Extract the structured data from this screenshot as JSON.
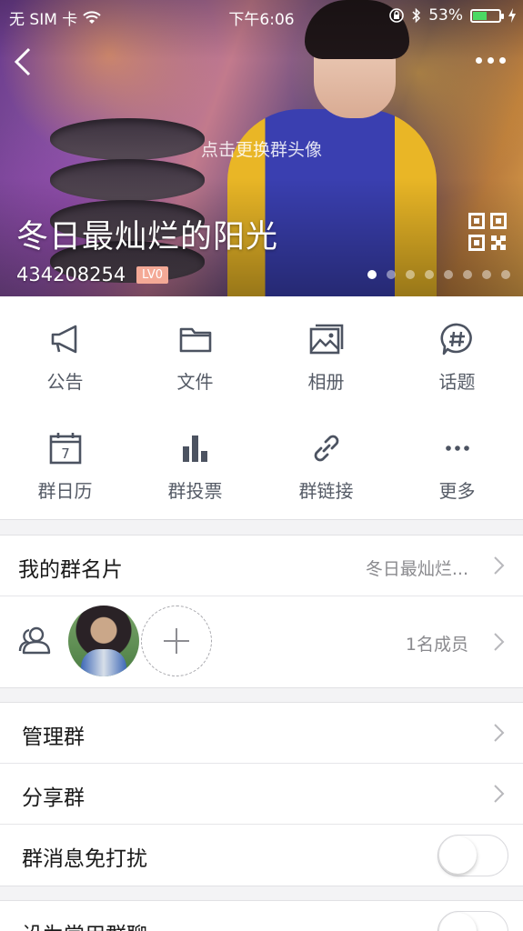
{
  "status_bar": {
    "carrier": "无 SIM 卡",
    "time": "下午6:06",
    "battery": "53%",
    "battery_level": 0.53
  },
  "header": {
    "avatar_hint": "点击更换群头像",
    "group_name": "冬日最灿烂的阳光",
    "group_id": "434208254",
    "level": "LV0",
    "carousel_pages": 8,
    "carousel_active": 0
  },
  "features": [
    {
      "label": "公告",
      "icon": "megaphone-icon"
    },
    {
      "label": "文件",
      "icon": "folder-icon"
    },
    {
      "label": "相册",
      "icon": "album-icon"
    },
    {
      "label": "话题",
      "icon": "topic-icon"
    },
    {
      "label": "群日历",
      "icon": "calendar-icon",
      "day": "7"
    },
    {
      "label": "群投票",
      "icon": "vote-icon"
    },
    {
      "label": "群链接",
      "icon": "link-icon"
    },
    {
      "label": "更多",
      "icon": "more-icon"
    }
  ],
  "card_section": {
    "my_card_label": "我的群名片",
    "my_card_value": "冬日最灿烂...",
    "members_count": "1名成员"
  },
  "settings": {
    "manage_label": "管理群",
    "share_label": "分享群",
    "mute_label": "群消息免打扰",
    "mute_on": false,
    "frequent_label": "设为常用群聊",
    "frequent_on": false
  }
}
